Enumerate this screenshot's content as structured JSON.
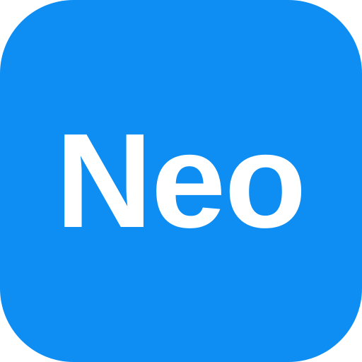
{
  "app_icon": {
    "label": "Neo",
    "colors": {
      "background": "#0E8EF3",
      "text": "#FFFFFF"
    }
  }
}
